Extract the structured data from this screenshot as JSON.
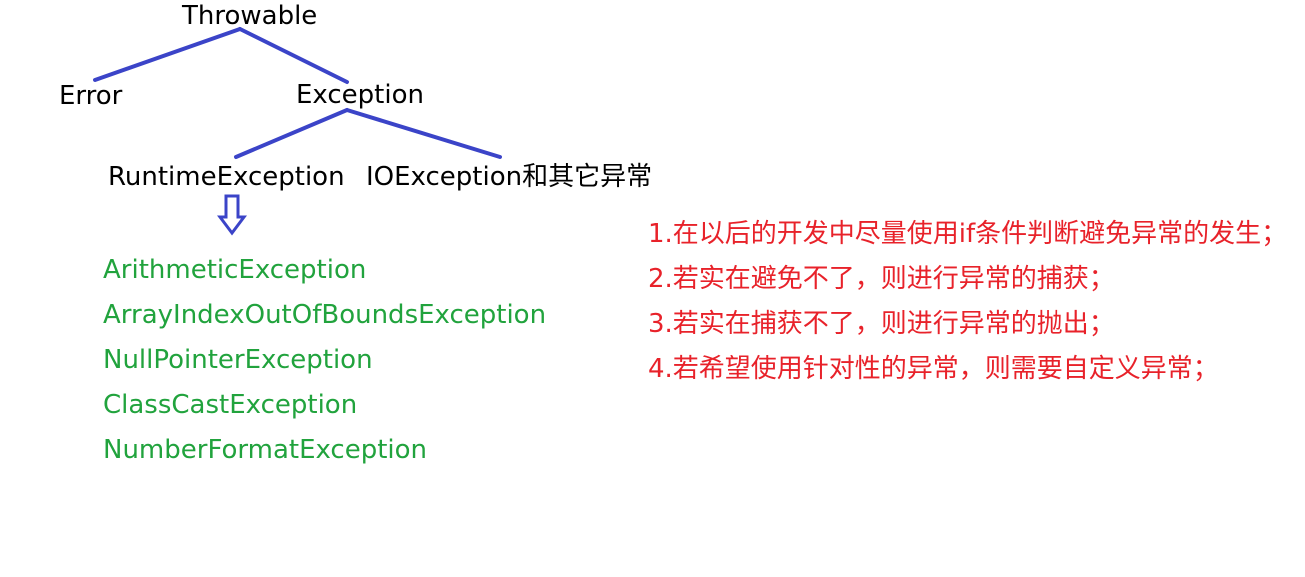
{
  "colors": {
    "line": "#3b44c8",
    "node_text": "#000000",
    "runtime_subclass_text": "#21a33d",
    "tip_text": "#e8222a"
  },
  "hierarchy": {
    "root": "Throwable",
    "error": "Error",
    "exception": "Exception",
    "runtime_exception": "RuntimeException",
    "io_exception": "IOException和其它异常"
  },
  "runtime_subclasses": [
    "ArithmeticException",
    "ArrayIndexOutOfBoundsException",
    "NullPointerException",
    "ClassCastException",
    "NumberFormatException"
  ],
  "tips": [
    "1.在以后的开发中尽量使用if条件判断避免异常的发生；",
    "2.若实在避免不了，则进行异常的捕获；",
    "3.若实在捕获不了，则进行异常的抛出；",
    "4.若希望使用针对性的异常，则需要自定义异常；"
  ],
  "icons": {
    "down_arrow": "hollow-down-arrow-icon"
  }
}
